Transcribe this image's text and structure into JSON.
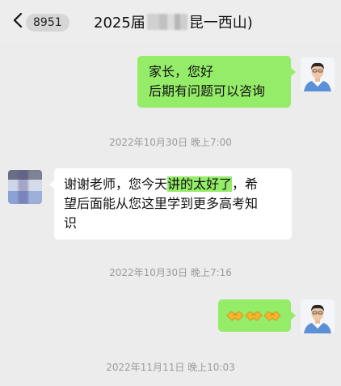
{
  "header": {
    "unread_count": "8951",
    "title_prefix": "2025届",
    "title_suffix": "昆一西山)"
  },
  "messages": [
    {
      "id": "m1",
      "sender": "me",
      "lines": [
        "家长，您好",
        "后期有问题可以咨询"
      ]
    },
    {
      "id": "m2",
      "sender": "other",
      "lines": [
        {
          "pre": "谢谢老师，您今天",
          "highlight": "讲的太好了",
          "post": "，希"
        },
        "望后面能从您这里学到更多高考知",
        "识"
      ]
    },
    {
      "id": "m3",
      "sender": "me",
      "emoji": [
        "handshake-emoji",
        "handshake-emoji",
        "handshake-emoji"
      ]
    }
  ],
  "timestamps": [
    "2022年10月30日 晚上7:00",
    "2022年10月30日 晚上7:16",
    "2022年11月11日 晚上10:03"
  ],
  "colors": {
    "background": "#ececec",
    "my_bubble": "#95ec69",
    "other_bubble": "#ffffff",
    "timestamp_text": "#9b9b9b"
  },
  "icons": [
    "chevron-left-icon",
    "teacher-avatar",
    "student-avatar",
    "handshake-emoji"
  ]
}
